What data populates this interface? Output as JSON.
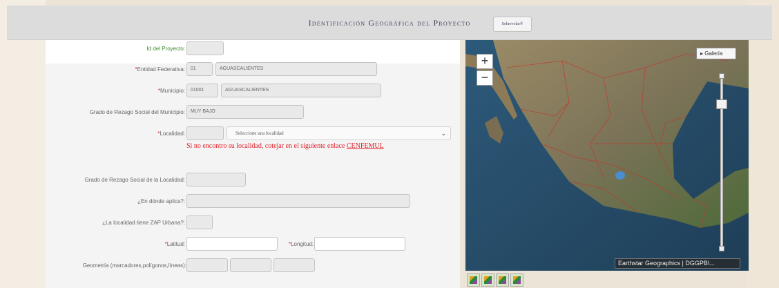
{
  "header": {
    "title": "Identificación Geográfica del Proyecto",
    "button_label": "Sobrevolar®"
  },
  "form": {
    "id_proyecto": {
      "label": "Id del Proyecto:",
      "value": ""
    },
    "entidad": {
      "label": "Entidad Federativa:",
      "required_mark": "*",
      "code": "01",
      "name": "AGUASCALIENTES"
    },
    "municipio": {
      "label": "Municipio:",
      "required_mark": "*",
      "code": "01001",
      "name": "AGUASCALIENTES"
    },
    "rezago_municipio": {
      "label": "Grado de Rezago Social del Municipio:",
      "value": "MUY BAJO"
    },
    "localidad": {
      "label": "Localidad:",
      "required_mark": "*",
      "code": "",
      "select_value": "Seleccione una localidad"
    },
    "warning": {
      "text": "Si no encontro su localidad, cotejar en el siguiente enlace",
      "link": "CENFEMUL"
    },
    "rezago_localidad": {
      "label": "Grado de Rezago Social de la Localidad:",
      "value": ""
    },
    "donde_aplica": {
      "label": "¿En dónde aplica?:",
      "value": ""
    },
    "zap_urbana": {
      "label": "¿La localidad tiene ZAP Urbana?:",
      "value": ""
    },
    "latitud": {
      "label": "Latitud:",
      "required_mark": "*",
      "value": ""
    },
    "longitud": {
      "label": "Longitud:",
      "required_mark": "*",
      "value": ""
    },
    "geometria": {
      "label": "Geometría (marcadores,polígonos,líneas):",
      "values": [
        "",
        "",
        ""
      ]
    }
  },
  "map": {
    "zoom_in": "+",
    "zoom_out": "−",
    "gallery_label": "▸ Galería",
    "attribution": "Earthstar Geographics | DGGPB\\...",
    "zoom_level": 0.85
  },
  "tools": [
    "marker-tool-icon",
    "polygon-tool-icon",
    "line-tool-icon",
    "edit-tool-icon"
  ]
}
